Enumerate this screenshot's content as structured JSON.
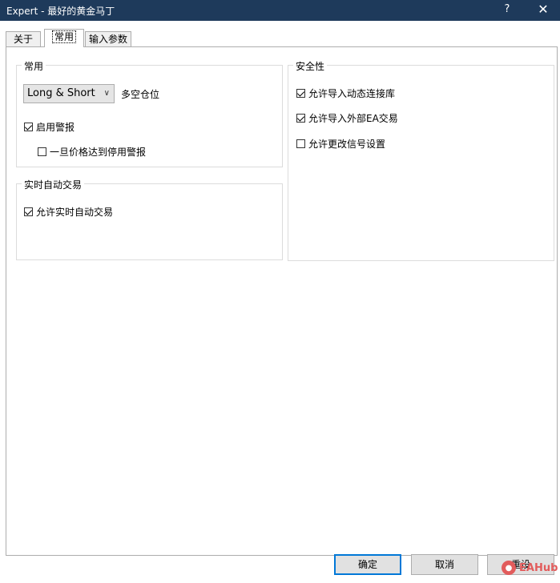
{
  "window": {
    "title": "Expert - 最好的黄金马丁",
    "help_label": "?",
    "close_label": "✕"
  },
  "tabs": [
    {
      "label": "关于"
    },
    {
      "label": "常用"
    },
    {
      "label": "输入参数"
    }
  ],
  "groups": {
    "common": {
      "title": "常用",
      "position_select_value": "Long & Short",
      "position_label": "多空仓位",
      "enable_alerts_label": "启用警报",
      "enable_alerts_checked": true,
      "disable_alert_label": "一旦价格达到停用警报",
      "disable_alert_checked": false
    },
    "live_trading": {
      "title": "实时自动交易",
      "allow_live_label": "允许实时自动交易",
      "allow_live_checked": true
    },
    "security": {
      "title": "安全性",
      "allow_dll_label": "允许导入动态连接库",
      "allow_dll_checked": true,
      "allow_external_label": "允许导入外部EA交易",
      "allow_external_checked": true,
      "allow_signal_label": "允许更改信号设置",
      "allow_signal_checked": false
    }
  },
  "buttons": {
    "ok_label": "确定",
    "cancel_label": "取消",
    "reset_label": "重设"
  },
  "watermark": {
    "text": "EAHub"
  }
}
